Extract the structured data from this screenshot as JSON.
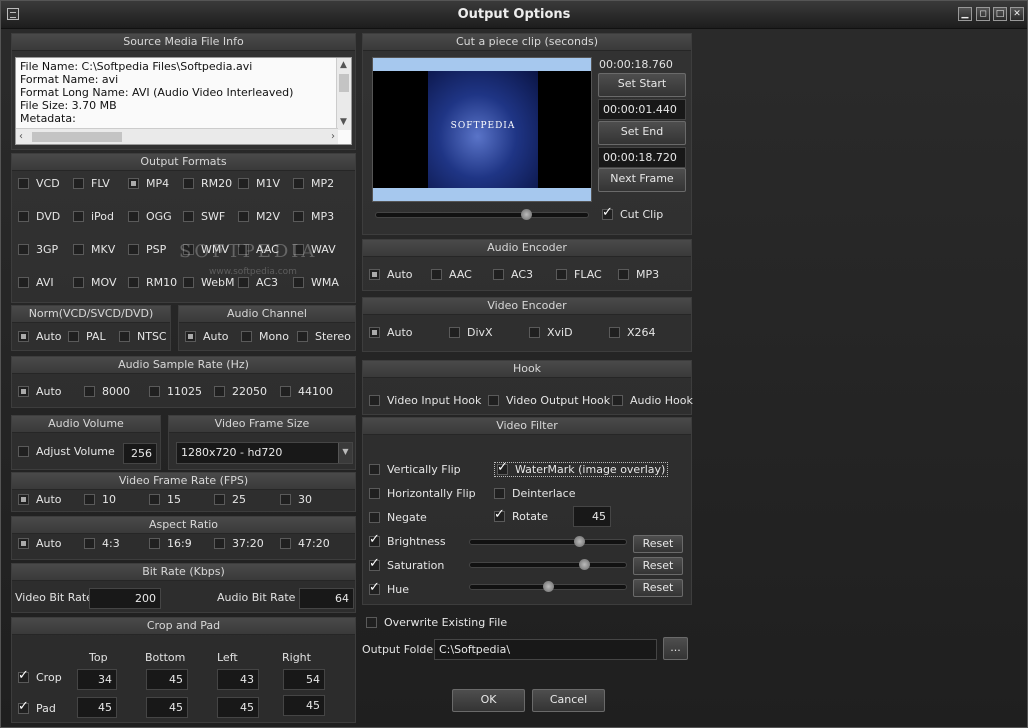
{
  "window": {
    "title": "Output Options",
    "min": "▁",
    "restore": "◻",
    "max": "□",
    "close": "✕"
  },
  "source": {
    "title": "Source Media File Info",
    "lines": [
      "File Name: C:\\Softpedia Files\\Softpedia.avi",
      "Format Name: avi",
      "Format Long Name: AVI (Audio Video Interleaved)",
      "File Size: 3.70 MB",
      "Metadata:"
    ]
  },
  "formats": {
    "title": "Output Formats",
    "items": [
      {
        "label": "VCD",
        "selected": false
      },
      {
        "label": "FLV",
        "selected": false
      },
      {
        "label": "MP4",
        "selected": true
      },
      {
        "label": "RM20",
        "selected": false
      },
      {
        "label": "M1V",
        "selected": false
      },
      {
        "label": "MP2",
        "selected": false
      },
      {
        "label": "DVD",
        "selected": false
      },
      {
        "label": "iPod",
        "selected": false
      },
      {
        "label": "OGG",
        "selected": false
      },
      {
        "label": "SWF",
        "selected": false
      },
      {
        "label": "M2V",
        "selected": false
      },
      {
        "label": "MP3",
        "selected": false
      },
      {
        "label": "3GP",
        "selected": false
      },
      {
        "label": "MKV",
        "selected": false
      },
      {
        "label": "PSP",
        "selected": false
      },
      {
        "label": "WMV",
        "selected": false
      },
      {
        "label": "AAC",
        "selected": false
      },
      {
        "label": "WAV",
        "selected": false
      },
      {
        "label": "AVI",
        "selected": false
      },
      {
        "label": "MOV",
        "selected": false
      },
      {
        "label": "RM10",
        "selected": false
      },
      {
        "label": "WebM",
        "selected": false
      },
      {
        "label": "AC3",
        "selected": false
      },
      {
        "label": "WMA",
        "selected": false
      }
    ]
  },
  "watermark": {
    "brand": "SOFTPEDIA",
    "url": "www.softpedia.com"
  },
  "norm": {
    "title": "Norm(VCD/SVCD/DVD)",
    "items": [
      "Auto",
      "PAL",
      "NTSC"
    ]
  },
  "audio_channel": {
    "title": "Audio Channel",
    "items": [
      "Auto",
      "Mono",
      "Stereo"
    ]
  },
  "sample_rate": {
    "title": "Audio Sample Rate (Hz)",
    "items": [
      "Auto",
      "8000",
      "11025",
      "22050",
      "44100"
    ]
  },
  "audio_volume": {
    "title": "Audio Volume",
    "adjust_label": "Adjust Volume",
    "value": "256"
  },
  "frame_size": {
    "title": "Video Frame Size",
    "value": "1280x720 - hd720"
  },
  "frame_rate": {
    "title": "Video Frame Rate (FPS)",
    "items": [
      "Auto",
      "10",
      "15",
      "25",
      "30"
    ]
  },
  "aspect": {
    "title": "Aspect Ratio",
    "items": [
      "Auto",
      "4:3",
      "16:9",
      "37:20",
      "47:20"
    ]
  },
  "bitrate": {
    "title": "Bit Rate (Kbps)",
    "video_label": "Video Bit Rate",
    "video_value": "200",
    "audio_label": "Audio Bit Rate",
    "audio_value": "64"
  },
  "crop": {
    "title": "Crop and Pad",
    "cols": [
      "Top",
      "Bottom",
      "Left",
      "Right"
    ],
    "crop_label": "Crop",
    "crop_values": [
      "34",
      "45",
      "43",
      "54"
    ],
    "pad_label": "Pad",
    "pad_values": [
      "45",
      "45",
      "45",
      "45"
    ]
  },
  "clip": {
    "title": "Cut a piece clip (seconds)",
    "time_current": "00:00:18.760",
    "set_start": "Set Start",
    "start_value": "00:00:01.440",
    "set_end": "Set End",
    "end_value": "00:00:18.720",
    "next_frame": "Next Frame",
    "cut_clip": "Cut Clip",
    "preview_brand": "SOFTPEDIA",
    "slider_position": 0.72
  },
  "audio_encoder": {
    "title": "Audio Encoder",
    "items": [
      "Auto",
      "AAC",
      "AC3",
      "FLAC",
      "MP3"
    ]
  },
  "video_encoder": {
    "title": "Video Encoder",
    "items": [
      "Auto",
      "DivX",
      "XviD",
      "X264"
    ]
  },
  "hook": {
    "title": "Hook",
    "items": [
      "Video Input Hook",
      "Video Output Hook",
      "Audio Hook"
    ]
  },
  "filter": {
    "title": "Video Filter",
    "vflip": "Vertically Flip",
    "hflip": "Horizontally Flip",
    "negate": "Negate",
    "watermark": "WaterMark (image overlay)",
    "deinterlace": "Deinterlace",
    "rotate": "Rotate",
    "rotate_value": "45",
    "brightness": "Brightness",
    "saturation": "Saturation",
    "hue": "Hue",
    "reset": "Reset",
    "brightness_level": 0.72,
    "saturation_level": 0.75,
    "hue_level": 0.5
  },
  "output": {
    "overwrite": "Overwrite Existing File",
    "folder_label": "Output Folder",
    "folder_value": "C:\\Softpedia\\",
    "browse": "...",
    "ok": "OK",
    "cancel": "Cancel"
  }
}
